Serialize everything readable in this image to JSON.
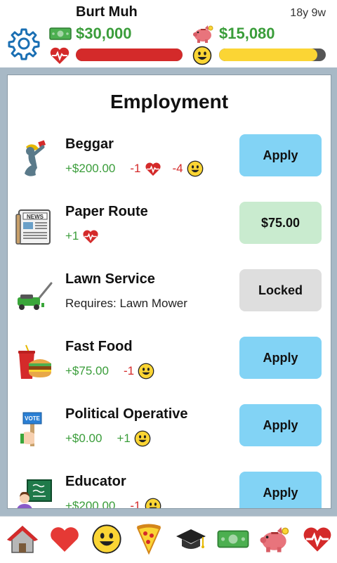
{
  "header": {
    "name": "Burt Muh",
    "age": "18y 9w",
    "money": "$30,000",
    "savings": "$15,080",
    "health_level": 1.0,
    "happiness_level": 0.92
  },
  "page": {
    "title": "Employment"
  },
  "jobs": [
    {
      "title": "Beggar",
      "stats": [
        {
          "value": "+$200.00",
          "kind": "pos"
        },
        {
          "value": "-1",
          "kind": "neg",
          "icon": "heart-icon"
        },
        {
          "value": "-4",
          "kind": "neg",
          "icon": "smiley-icon"
        }
      ],
      "button": "Apply"
    },
    {
      "title": "Paper Route",
      "stats": [
        {
          "value": "+1",
          "kind": "pos",
          "icon": "heart-icon"
        }
      ],
      "button": "$75.00"
    },
    {
      "title": "Lawn Service",
      "requirement": "Requires: Lawn Mower",
      "button": "Locked"
    },
    {
      "title": "Fast Food",
      "stats": [
        {
          "value": "+$75.00",
          "kind": "pos"
        },
        {
          "value": "-1",
          "kind": "neg",
          "icon": "smiley-icon"
        }
      ],
      "button": "Apply"
    },
    {
      "title": "Political Operative",
      "stats": [
        {
          "value": "+$0.00",
          "kind": "pos"
        },
        {
          "value": "+1",
          "kind": "pos",
          "icon": "smiley-icon"
        }
      ],
      "button": "Apply"
    },
    {
      "title": "Educator",
      "stats": [
        {
          "value": "+$200.00",
          "kind": "pos"
        },
        {
          "value": "-1",
          "kind": "neg",
          "icon": "smiley-icon"
        }
      ],
      "button": "Apply"
    }
  ],
  "nav": [
    "home-icon",
    "heart-icon",
    "smiley-icon",
    "pizza-icon",
    "graduation-cap-icon",
    "money-icon",
    "piggy-bank-icon",
    "heart-pulse-icon"
  ],
  "colors": {
    "positive": "#3a9d3a",
    "negative": "#d42a2a",
    "apply": "#82d3f5",
    "promotion": "#c9ebcf",
    "locked": "#dedede",
    "health": "#d42a2a",
    "happiness": "#fbd534"
  }
}
